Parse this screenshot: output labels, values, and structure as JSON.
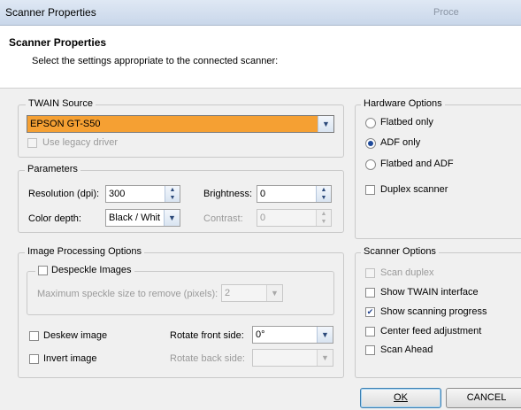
{
  "window": {
    "title": "Scanner Properties",
    "title_right": "Proce"
  },
  "header": {
    "title": "Scanner Properties",
    "subtitle": "Select the settings appropriate to the connected scanner:"
  },
  "twain": {
    "legend": "TWAIN Source",
    "source": "EPSON GT-S50",
    "use_legacy": "Use legacy driver"
  },
  "parameters": {
    "legend": "Parameters",
    "resolution_label": "Resolution (dpi):",
    "resolution_value": "300",
    "brightness_label": "Brightness:",
    "brightness_value": "0",
    "color_depth_label": "Color depth:",
    "color_depth_value": "Black / Whit",
    "contrast_label": "Contrast:",
    "contrast_value": "0"
  },
  "image_processing": {
    "legend": "Image Processing Options",
    "despeckle": "Despeckle Images",
    "speckle_label": "Maximum speckle size to remove (pixels):",
    "speckle_value": "2",
    "deskew": "Deskew image",
    "invert": "Invert image",
    "rotate_front_label": "Rotate front side:",
    "rotate_front_value": "0°",
    "rotate_back_label": "Rotate back side:",
    "rotate_back_value": ""
  },
  "hardware": {
    "legend": "Hardware Options",
    "flatbed_only": "Flatbed only",
    "adf_only": "ADF only",
    "flatbed_adf": "Flatbed and ADF",
    "duplex": "Duplex scanner",
    "selected": "adf_only"
  },
  "scanner_options": {
    "legend": "Scanner Options",
    "scan_duplex": "Scan duplex",
    "show_twain": "Show TWAIN interface",
    "show_progress": "Show scanning progress",
    "center_feed": "Center feed adjustment",
    "scan_ahead": "Scan Ahead"
  },
  "buttons": {
    "ok": "OK",
    "cancel": "CANCEL"
  },
  "colors": {
    "source_highlight": "#f5a033",
    "accent": "#1e4a9a"
  }
}
